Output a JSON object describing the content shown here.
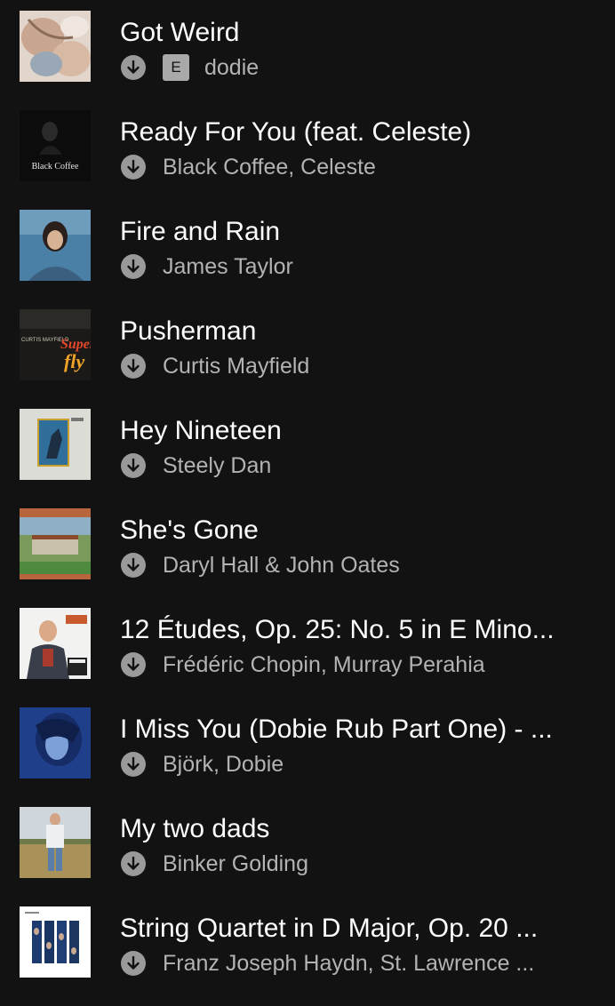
{
  "icons": {
    "download": "download-arrow-icon",
    "explicit": "explicit-badge"
  },
  "colors": {
    "background": "#121212",
    "title": "#ffffff",
    "subtitle": "#b3b3b3",
    "download_icon": "#9a9a9a"
  },
  "tracks": [
    {
      "title": "Got Weird",
      "artist": "dodie",
      "explicit": "E",
      "downloaded": true
    },
    {
      "title": "Ready For You (feat. Celeste)",
      "artist": "Black Coffee, Celeste",
      "cover_text": "Black Coffee",
      "downloaded": true
    },
    {
      "title": "Fire and Rain",
      "artist": "James Taylor",
      "downloaded": true
    },
    {
      "title": "Pusherman",
      "artist": "Curtis Mayfield",
      "cover_text": "CURTIS MAYFIELD",
      "downloaded": true
    },
    {
      "title": "Hey Nineteen",
      "artist": "Steely Dan",
      "downloaded": true
    },
    {
      "title": "She's Gone",
      "artist": "Daryl Hall & John Oates",
      "downloaded": true
    },
    {
      "title": "12 Études, Op. 25: No. 5 in E Mino...",
      "artist": "Frédéric Chopin, Murray Perahia",
      "downloaded": true
    },
    {
      "title": "I Miss You (Dobie Rub Part One) - ...",
      "artist": "Björk, Dobie",
      "downloaded": true
    },
    {
      "title": "My two dads",
      "artist": "Binker Golding",
      "downloaded": true
    },
    {
      "title": "String Quartet in D Major, Op. 20 ...",
      "artist": "Franz Joseph Haydn, St. Lawrence ...",
      "downloaded": true
    }
  ]
}
